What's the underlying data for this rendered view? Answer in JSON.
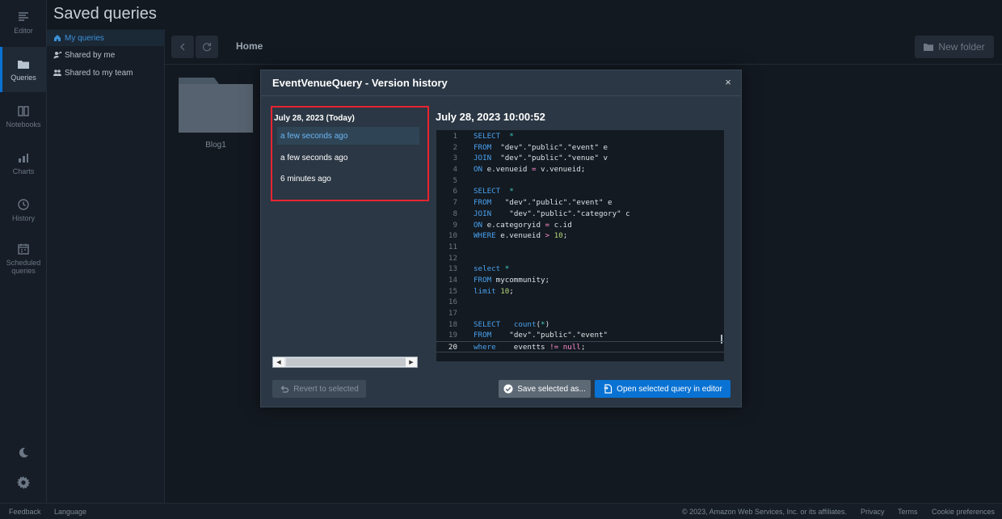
{
  "page_title": "Saved queries",
  "rail": {
    "items": [
      {
        "label": "Editor"
      },
      {
        "label": "Queries"
      },
      {
        "label": "Notebooks"
      },
      {
        "label": "Charts"
      },
      {
        "label": "History"
      },
      {
        "label": "Scheduled",
        "label2": "queries"
      }
    ]
  },
  "subnav": {
    "items": [
      {
        "label": "My queries"
      },
      {
        "label": "Shared by me"
      },
      {
        "label": "Shared to my team"
      }
    ]
  },
  "toolbar": {
    "breadcrumb": "Home",
    "new_folder": "New folder"
  },
  "folders": [
    {
      "name": "Blog1"
    }
  ],
  "modal": {
    "title": "EventVenueQuery - Version history",
    "close": "×",
    "group_date": "July 28, 2023 (Today)",
    "versions": [
      {
        "label": "a few seconds ago"
      },
      {
        "label": "a few seconds ago"
      },
      {
        "label": "6 minutes ago"
      }
    ],
    "selected_timestamp": "July 28, 2023 10:00:52",
    "revert_label": "Revert to selected",
    "save_as_label": "Save selected as...",
    "open_label": "Open selected query in editor",
    "code_lines": [
      "SELECT  *",
      "FROM  \"dev\".\"public\".\"event\" e",
      "JOIN  \"dev\".\"public\".\"venue\" v",
      "ON e.venueid = v.venueid;",
      "",
      "SELECT  *",
      "FROM   \"dev\".\"public\".\"event\" e",
      "JOIN    \"dev\".\"public\".\"category\" c",
      "ON e.categoryid = c.id",
      "WHERE e.venueid > 10;",
      "",
      "",
      "select *",
      "FROM mycommunity;",
      "limit 10;",
      "",
      "",
      "SELECT   count(*)",
      "FROM    \"dev\".\"public\".\"event\"",
      "where    eventts != null;"
    ]
  },
  "footer": {
    "feedback": "Feedback",
    "language": "Language",
    "copyright": "© 2023, Amazon Web Services, Inc. or its affiliates.",
    "privacy": "Privacy",
    "terms": "Terms",
    "cookies": "Cookie preferences"
  },
  "colors": {
    "accent": "#0972d3",
    "highlight_border": "#e8232f",
    "background": "#131920"
  }
}
